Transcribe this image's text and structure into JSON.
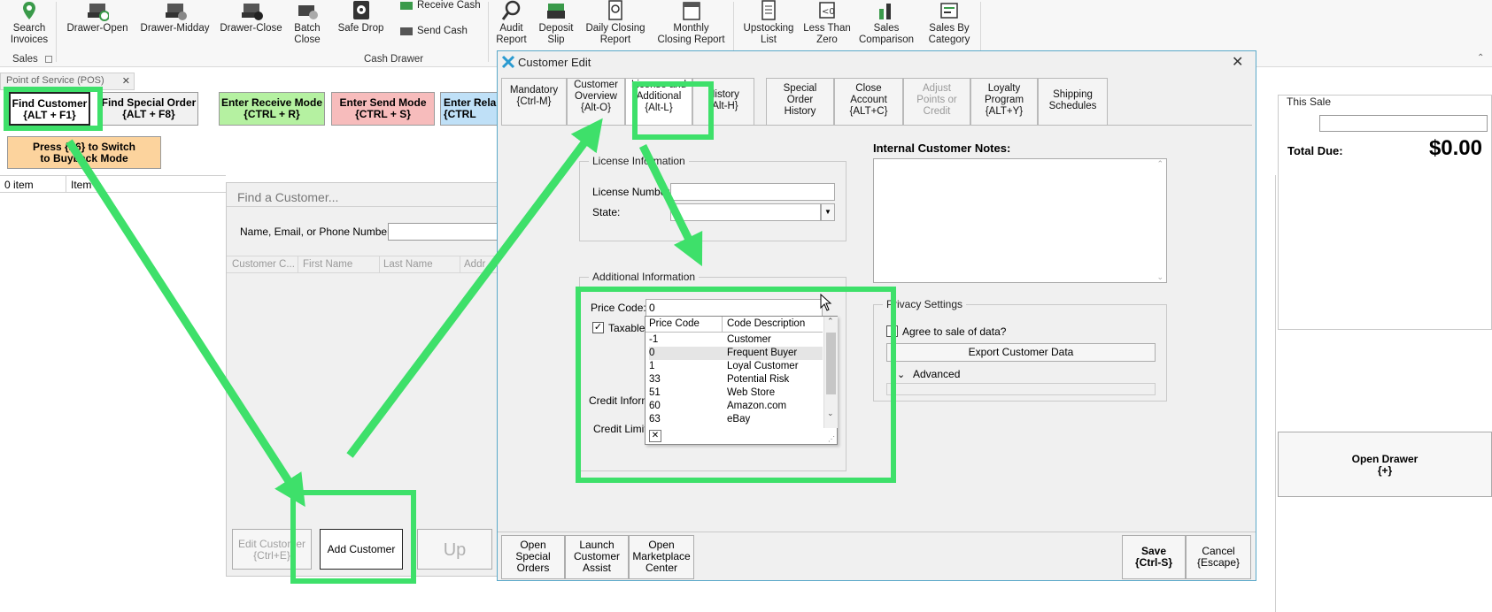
{
  "ribbon": {
    "search_invoices": "Search\nInvoices",
    "drawer_open": "Drawer-Open",
    "drawer_midday": "Drawer-Midday",
    "drawer_close": "Drawer-Close",
    "batch_close": "Batch\nClose",
    "safe_drop": "Safe Drop",
    "receive_cash": "Receive Cash",
    "send_cash": "Send Cash",
    "audit_report": "Audit\nReport",
    "deposit_slip": "Deposit\nSlip",
    "daily_closing": "Daily Closing\nReport",
    "monthly_closing": "Monthly\nClosing Report",
    "upstocking": "Upstocking\nList",
    "less_than_zero": "Less Than\nZero",
    "sales_comparison": "Sales\nComparison",
    "sales_by_category": "Sales By\nCategory",
    "group_sales": "Sales",
    "group_cash_drawer": "Cash Drawer"
  },
  "pos": {
    "tab_label": "Point of Service (POS)",
    "find_customer": "Find Customer\n{ALT + F1}",
    "find_special_order": "Find Special Order\n{ALT + F8}",
    "enter_receive_mode": "Enter Receive Mode\n{CTRL + R}",
    "enter_send_mode": "Enter Send Mode\n{CTRL + S}",
    "enter_related": "Enter Rela\n{CTRL",
    "buyback": "Press {F6} to Switch\nto Buyback Mode",
    "items_count": "0 item",
    "items_col": "Item",
    "this_sale": "This Sale",
    "total_due_label": "Total Due:",
    "total_due_value": "$0.00",
    "open_drawer": "Open Drawer\n{+}"
  },
  "find_dialog": {
    "title": "Find a Customer...",
    "search_label": "Name, Email, or Phone Number:",
    "columns": [
      "Customer C...",
      "First Name",
      "Last Name",
      "Addr"
    ],
    "edit_customer": "Edit Customer\n{Ctrl+E}",
    "add_customer": "Add Customer",
    "up": "Up"
  },
  "edit_dialog": {
    "title": "Customer Edit",
    "tabs": [
      {
        "label": "Mandatory\n{Ctrl-M}"
      },
      {
        "label": "Customer\nOverview\n{Alt-O}"
      },
      {
        "label": "License and\nAdditional\n{Alt-L}"
      },
      {
        "label": "History\n{Alt-H}"
      },
      {
        "label": "Special\nOrder\nHistory"
      },
      {
        "label": "Close\nAccount\n{ALT+C}"
      },
      {
        "label": "Adjust\nPoints or\nCredit"
      },
      {
        "label": "Loyalty\nProgram\n{ALT+Y}"
      },
      {
        "label": "Shipping\nSchedules"
      }
    ],
    "license_legend": "License Information",
    "license_number_label": "License Number:",
    "state_label": "State:",
    "additional_legend": "Additional Information",
    "price_code_label": "Price Code:",
    "price_code_value": "0",
    "taxable_label": "Taxable?",
    "credit_info_label": "Credit Inform",
    "credit_limit_label": "Credit Limit",
    "dropdown": {
      "col_code": "Price Code",
      "col_desc": "Code Description",
      "rows": [
        {
          "code": "-1",
          "desc": "Customer"
        },
        {
          "code": "0",
          "desc": "Frequent Buyer"
        },
        {
          "code": "1",
          "desc": "Loyal Customer"
        },
        {
          "code": "33",
          "desc": "Potential Risk"
        },
        {
          "code": "51",
          "desc": "Web Store"
        },
        {
          "code": "60",
          "desc": "Amazon.com"
        },
        {
          "code": "63",
          "desc": "eBay"
        }
      ]
    },
    "notes_label": "Internal Customer Notes:",
    "privacy_legend": "Privacy Settings",
    "agree_label": "Agree to sale of data?",
    "export_data": "Export Customer Data",
    "advanced": "Advanced",
    "bottom": {
      "open_special_orders": "Open\nSpecial\nOrders",
      "launch_assist": "Launch\nCustomer\nAssist",
      "open_marketplace": "Open\nMarketplace\nCenter",
      "save": "Save\n{Ctrl-S}",
      "cancel": "Cancel\n{Escape}"
    }
  },
  "colors": {
    "highlight": "#3ee06a",
    "receive_mode_bg": "#b5f1a1",
    "send_mode_bg": "#f7bcbc",
    "related_bg": "#bfe0f7",
    "buyback_bg": "#fcd39d"
  }
}
